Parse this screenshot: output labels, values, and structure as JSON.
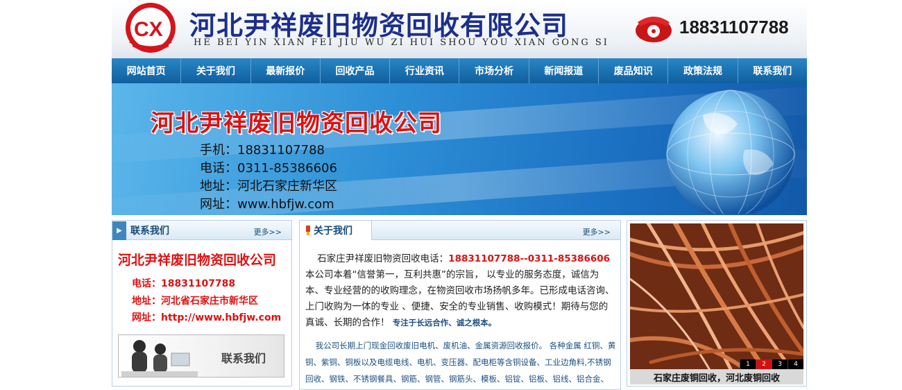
{
  "header": {
    "company_name": "河北尹祥废旧物资回收有限公司",
    "company_pinyin": "HE BEI YIN XIAN FEI JIU WU ZI HUI SHOU YOU XIAN GONG SI",
    "phone": "18831107788",
    "logo_icon": "cx-logo-icon",
    "phone_icon": "red-telephone-icon"
  },
  "nav": {
    "items": [
      "网站首页",
      "关于我们",
      "最新报价",
      "回收产品",
      "行业资讯",
      "市场分析",
      "新闻报道",
      "废品知识",
      "政策法规",
      "联系我们"
    ]
  },
  "banner": {
    "title": "河北尹祥废旧物资回收公司",
    "lines": [
      "手机：18831107788",
      "电话：0311-85386606",
      "地址：河北石家庄新华区",
      "网址：www.hbfjw.com"
    ]
  },
  "left_panel": {
    "title": "联系我们",
    "more": "更多>>",
    "company": "河北尹祥废旧物资回收公司",
    "lines": [
      "电话：18831107788",
      "地址：河北省石家庄市新华区",
      "网址：http://www.hbfjw.com"
    ],
    "contact_button": "联系我们"
  },
  "mid_panel": {
    "title": "关于我们",
    "more": "更多>>",
    "p1_prefix": "石家庄尹祥废旧物资回收电话：",
    "p1_phones": "18831107788--0311-85386606",
    "p1_rest": "本公司本着“信誉第一，互利共惠”的宗旨， 以专业的服务态度，诚信为本、专业经营的的收购理念，在物资回收市场扬帆多年。已形成电话咨询、上门收购为一体的专业 、便捷、安全的专业销售、收购模式！期待与您的真诚、长期的合作！",
    "p1_tail": "专注于长远合作、诚之根本。",
    "p2": "我公司长期上门现金回收废旧电机、废机油、金属资源回收报价。 各种金属 红铜、黄铜、紫铜、铜板以及电缆电线、电机、变压器、配电柜等含铜设备、工业边角料,不锈钢回收、钢铁、不锈钢餐具、钢筋、钢管、钢筋头、模板、铝锭、铝板、铝线、铝合金、铝合金门窗以及含铝的废旧设备、工业边角料回收。"
  },
  "right_panel": {
    "caption": "石家庄废铜回收，河北废铜回收",
    "pages": [
      "1",
      "2",
      "3",
      "4"
    ],
    "active_page": "2"
  },
  "colors": {
    "nav_blue": "#1a6fae",
    "title_navy": "#1d2f8c",
    "accent_red": "#e01010",
    "link_blue": "#1d4f84"
  }
}
